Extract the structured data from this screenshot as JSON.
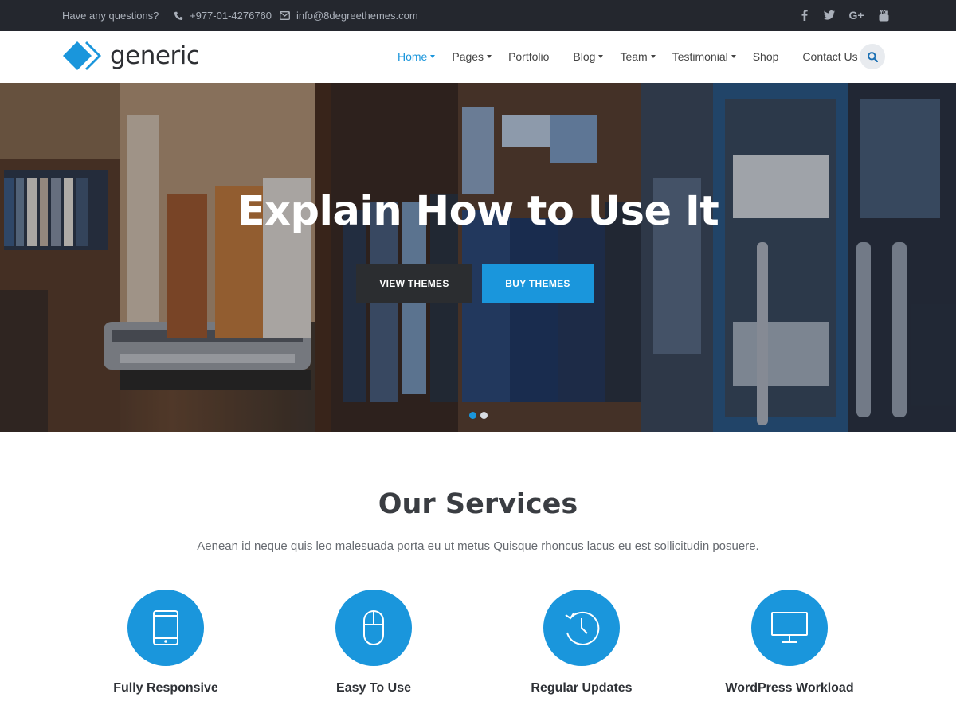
{
  "topbar": {
    "question": "Have any questions?",
    "phone": "+977-01-4276760",
    "email": "info@8degreethemes.com",
    "social": [
      "facebook-icon",
      "twitter-icon",
      "google-plus-icon",
      "youtube-icon"
    ]
  },
  "header": {
    "logo_text": "generic",
    "nav": [
      {
        "label": "Home",
        "dropdown": true,
        "active": true
      },
      {
        "label": "Pages",
        "dropdown": true
      },
      {
        "label": "Portfolio",
        "dropdown": false
      },
      {
        "label": "Blog",
        "dropdown": true
      },
      {
        "label": "Team",
        "dropdown": true
      },
      {
        "label": "Testimonial",
        "dropdown": true
      },
      {
        "label": "Shop",
        "dropdown": false
      },
      {
        "label": "Contact Us",
        "dropdown": false
      }
    ]
  },
  "hero": {
    "title": "Explain How to Use It",
    "btn_view": "VIEW THEMES",
    "btn_buy": "BUY THEMES",
    "slides": 2,
    "active_slide": 0
  },
  "services": {
    "title": "Our Services",
    "subtitle": "Aenean id neque quis leo malesuada porta eu ut metus Quisque rhoncus lacus eu est sollicitudin posuere.",
    "items": [
      {
        "icon": "tablet-icon",
        "title": "Fully Responsive"
      },
      {
        "icon": "mouse-icon",
        "title": "Easy To Use"
      },
      {
        "icon": "clock-history-icon",
        "title": "Regular Updates"
      },
      {
        "icon": "desktop-icon",
        "title": "WordPress Workload"
      }
    ]
  },
  "colors": {
    "accent": "#1a96dc",
    "topbar": "#24272e",
    "dark_button": "#2b2d30"
  }
}
